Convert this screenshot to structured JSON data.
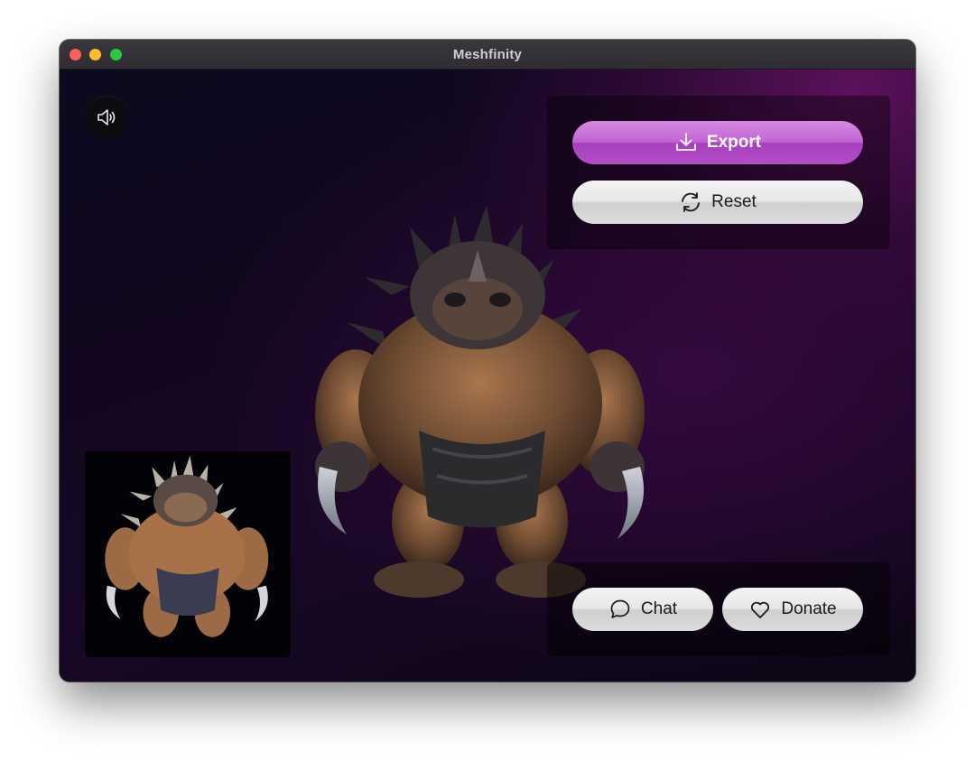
{
  "window": {
    "title": "Meshfinity"
  },
  "controls": {
    "export_label": "Export",
    "reset_label": "Reset",
    "chat_label": "Chat",
    "donate_label": "Donate"
  },
  "icons": {
    "speaker": "speaker-icon",
    "export": "download-icon",
    "reset": "refresh-icon",
    "chat": "chat-bubble-icon",
    "donate": "heart-icon"
  },
  "colors": {
    "export_accent": "#c165d4",
    "background_glow": "#5f125f",
    "button_gray": "#e6e6e6"
  }
}
